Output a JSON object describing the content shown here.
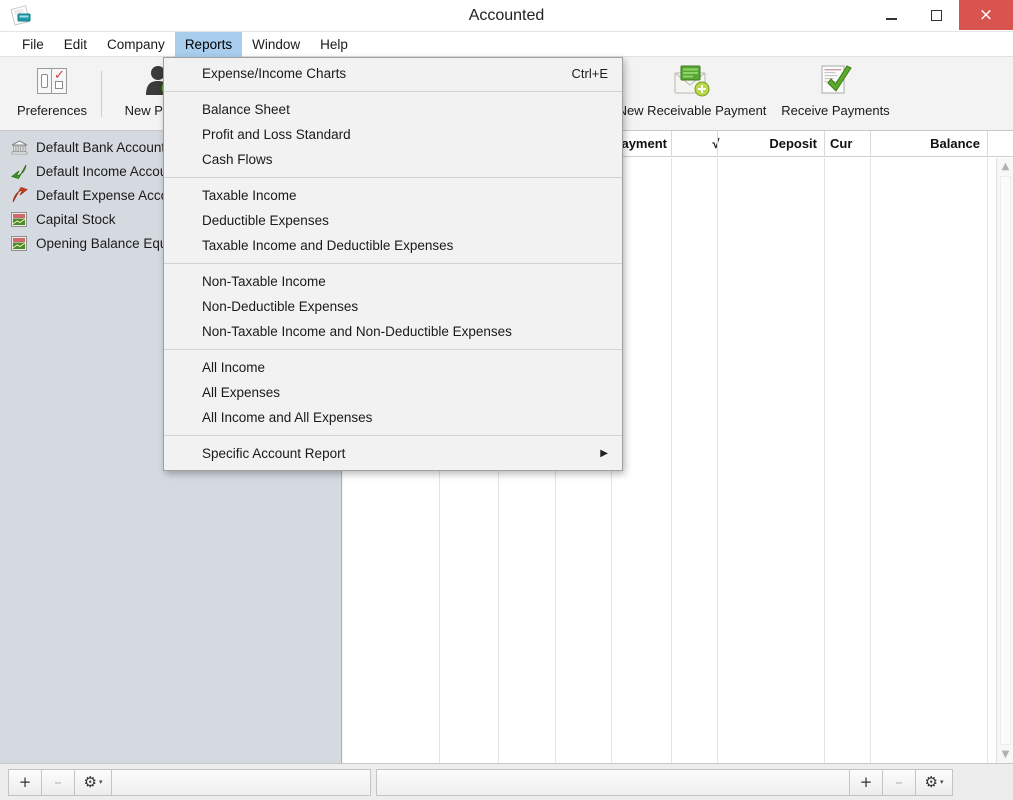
{
  "window": {
    "title": "Accounted",
    "app_icon": "accounted-app-icon",
    "minimize": "–",
    "maximize": "□",
    "close": "×"
  },
  "menubar": {
    "items": [
      {
        "label": "File",
        "active": false
      },
      {
        "label": "Edit",
        "active": false
      },
      {
        "label": "Company",
        "active": false
      },
      {
        "label": "Reports",
        "active": true
      },
      {
        "label": "Window",
        "active": false
      },
      {
        "label": "Help",
        "active": false
      }
    ]
  },
  "toolbar": {
    "items": [
      {
        "label": "Preferences",
        "icon": "preferences-icon"
      },
      {
        "label": "New Person",
        "icon": "new-person-icon"
      },
      {
        "label": "New Receivable Payment",
        "icon": "new-receivable-payment-icon"
      },
      {
        "label": "Receive Payments",
        "icon": "receive-payments-icon"
      }
    ]
  },
  "sidebar": {
    "accounts": [
      {
        "label": "Default Bank Account",
        "icon": "bank-icon"
      },
      {
        "label": "Default Income Account",
        "icon": "income-arrow-icon"
      },
      {
        "label": "Default Expense Account",
        "icon": "expense-arrow-icon"
      },
      {
        "label": "Capital Stock",
        "icon": "ledger-icon"
      },
      {
        "label": "Opening Balance Equity",
        "icon": "ledger-icon"
      }
    ]
  },
  "register": {
    "columns": [
      {
        "label": "Payment"
      },
      {
        "label": "√"
      },
      {
        "label": "Deposit"
      },
      {
        "label": "Cur"
      },
      {
        "label": "Balance"
      }
    ],
    "rows": []
  },
  "reports_menu": {
    "groups": [
      {
        "items": [
          {
            "label": "Expense/Income Charts",
            "accel": "Ctrl+E",
            "submenu": false
          }
        ]
      },
      {
        "items": [
          {
            "label": "Balance Sheet",
            "accel": "",
            "submenu": false
          },
          {
            "label": "Profit and Loss Standard",
            "accel": "",
            "submenu": false
          },
          {
            "label": "Cash Flows",
            "accel": "",
            "submenu": false
          }
        ]
      },
      {
        "items": [
          {
            "label": "Taxable Income",
            "accel": "",
            "submenu": false
          },
          {
            "label": "Deductible Expenses",
            "accel": "",
            "submenu": false
          },
          {
            "label": "Taxable Income and Deductible Expenses",
            "accel": "",
            "submenu": false
          }
        ]
      },
      {
        "items": [
          {
            "label": "Non-Taxable Income",
            "accel": "",
            "submenu": false
          },
          {
            "label": "Non-Deductible Expenses",
            "accel": "",
            "submenu": false
          },
          {
            "label": "Non-Taxable Income and Non-Deductible Expenses",
            "accel": "",
            "submenu": false
          }
        ]
      },
      {
        "items": [
          {
            "label": "All Income",
            "accel": "",
            "submenu": false
          },
          {
            "label": "All Expenses",
            "accel": "",
            "submenu": false
          },
          {
            "label": "All Income and All Expenses",
            "accel": "",
            "submenu": false
          }
        ]
      },
      {
        "items": [
          {
            "label": "Specific Account Report",
            "accel": "",
            "submenu": true
          }
        ]
      }
    ],
    "submenu_glyph": "▶"
  },
  "bottom_bar": {
    "left": {
      "add": "+",
      "remove": "–",
      "gear": "⚙",
      "caret": "▾"
    },
    "right": {
      "add": "+",
      "remove": "–",
      "gear": "⚙",
      "caret": "▾"
    }
  },
  "scrollbar": {
    "up": "▲",
    "down": "▼"
  },
  "colors": {
    "menu_highlight": "#a8cded",
    "sidebar_bg": "#d5dae1",
    "close_button": "#d9534f",
    "toolbar_bg": "#f3f3f3",
    "menu_bg": "#f2f2f2"
  }
}
